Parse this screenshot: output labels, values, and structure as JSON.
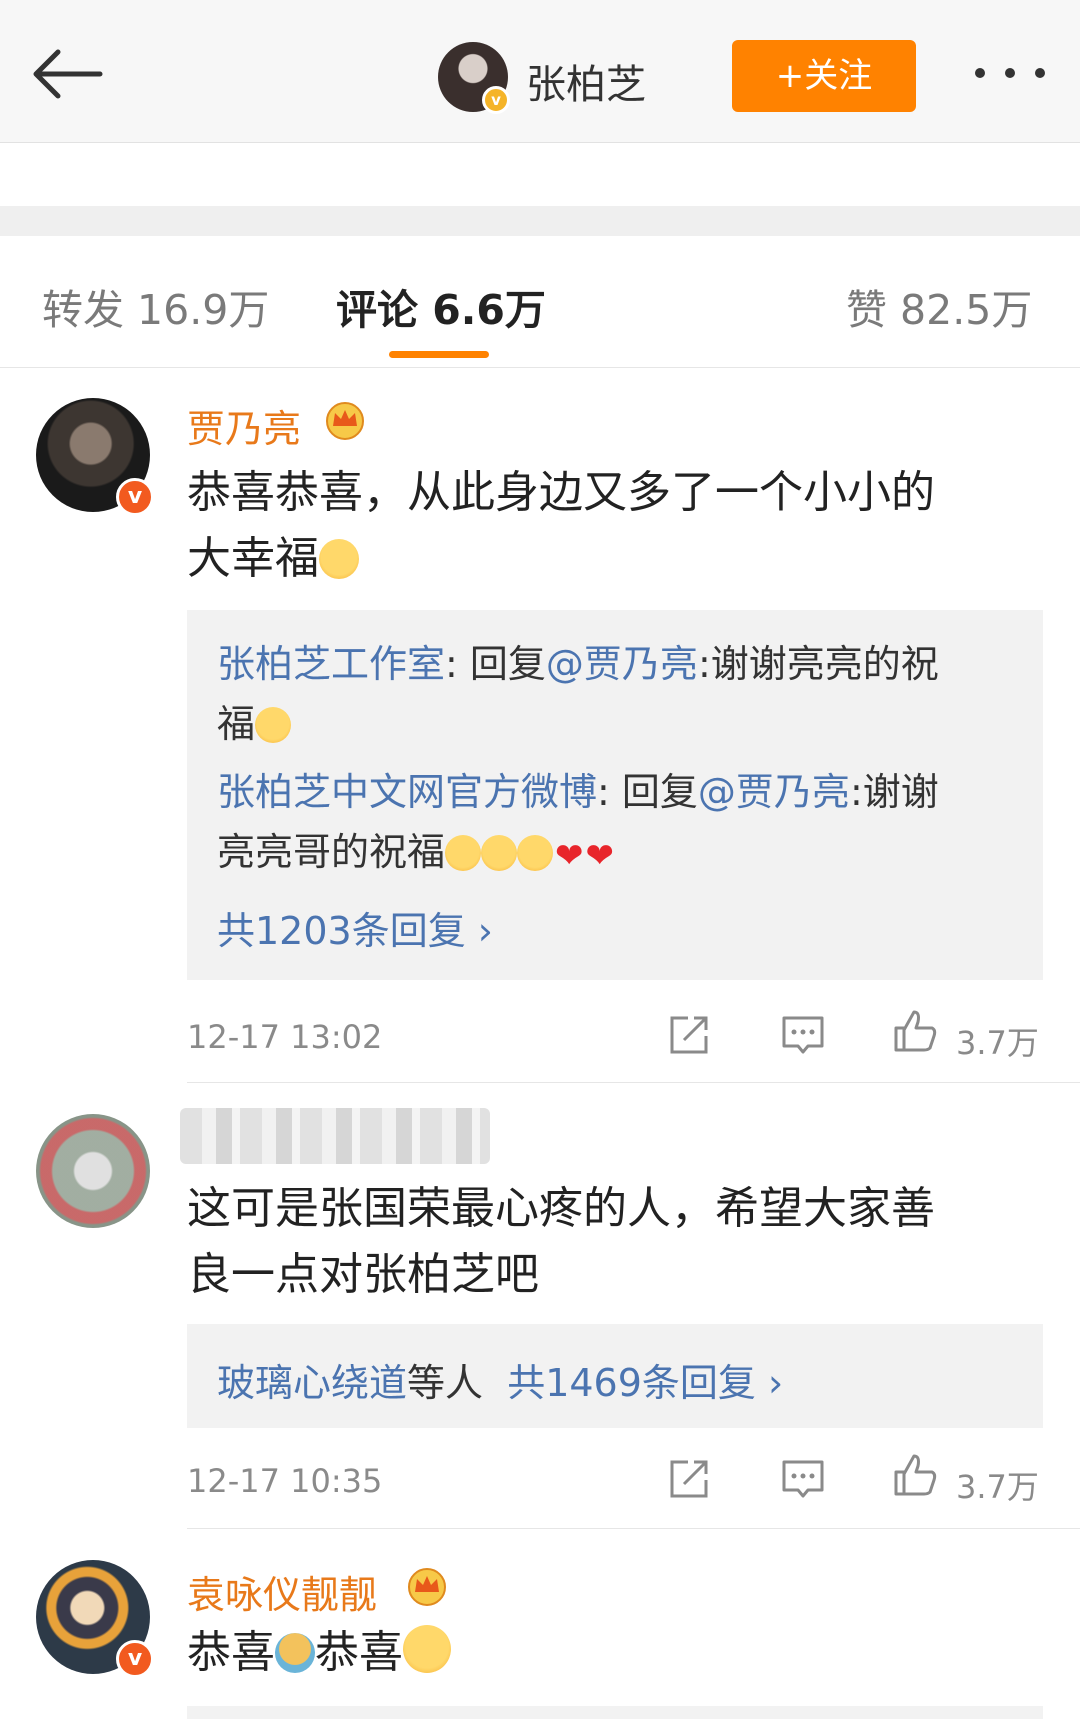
{
  "header": {
    "username": "张柏芝",
    "follow_label": "+关注",
    "icons": {
      "back": "back-arrow-icon",
      "more": "more-dots-icon",
      "verified": "verified-badge-icon"
    }
  },
  "tabs": [
    {
      "label": "转发 16.9万",
      "active": false
    },
    {
      "label": "评论 6.6万",
      "active": true
    },
    {
      "label": "赞 82.5万",
      "active": false
    }
  ],
  "comments": [
    {
      "username": "贾乃亮",
      "verified": true,
      "badge": "crown",
      "text_line1": "恭喜恭喜，从此身边又多了一个小小的",
      "text_line2": "大幸福",
      "emoji": "hug-emoji",
      "replies": [
        {
          "author": "张柏芝工作室",
          "colon": ":",
          "prefix": " 回复",
          "mention": "@贾乃亮",
          "content_line1": ":谢谢亮亮的祝",
          "content_line2": "福"
        },
        {
          "author": "张柏芝中文网官方微博",
          "colon": ":",
          "prefix": " 回复",
          "mention": "@贾乃亮",
          "content_line1": ":谢谢",
          "content_line2": "亮亮哥的祝福"
        }
      ],
      "reply_count": "共1203条回复 ›",
      "timestamp": "12-17 13:02",
      "likes": "3.7万"
    },
    {
      "username": "",
      "verified": false,
      "text_line1": "这可是张国荣最心疼的人，希望大家善",
      "text_line2": "良一点对张柏芝吧",
      "reply_summary_user": "玻璃心绕道",
      "reply_summary_suffix": "等人",
      "reply_count": "共1469条回复 ›",
      "timestamp": "12-17 10:35",
      "likes": "3.7万"
    },
    {
      "username": "袁咏仪靓靓",
      "verified": true,
      "badge": "crown",
      "text_part1": "恭喜",
      "text_part2": "恭喜",
      "emoji": "smile-emoji"
    }
  ],
  "colors": {
    "accent": "#ff8200",
    "username": "#e8791a",
    "link": "#4b74b0",
    "verified": "#f25a1f",
    "heart": "#e8252b"
  }
}
